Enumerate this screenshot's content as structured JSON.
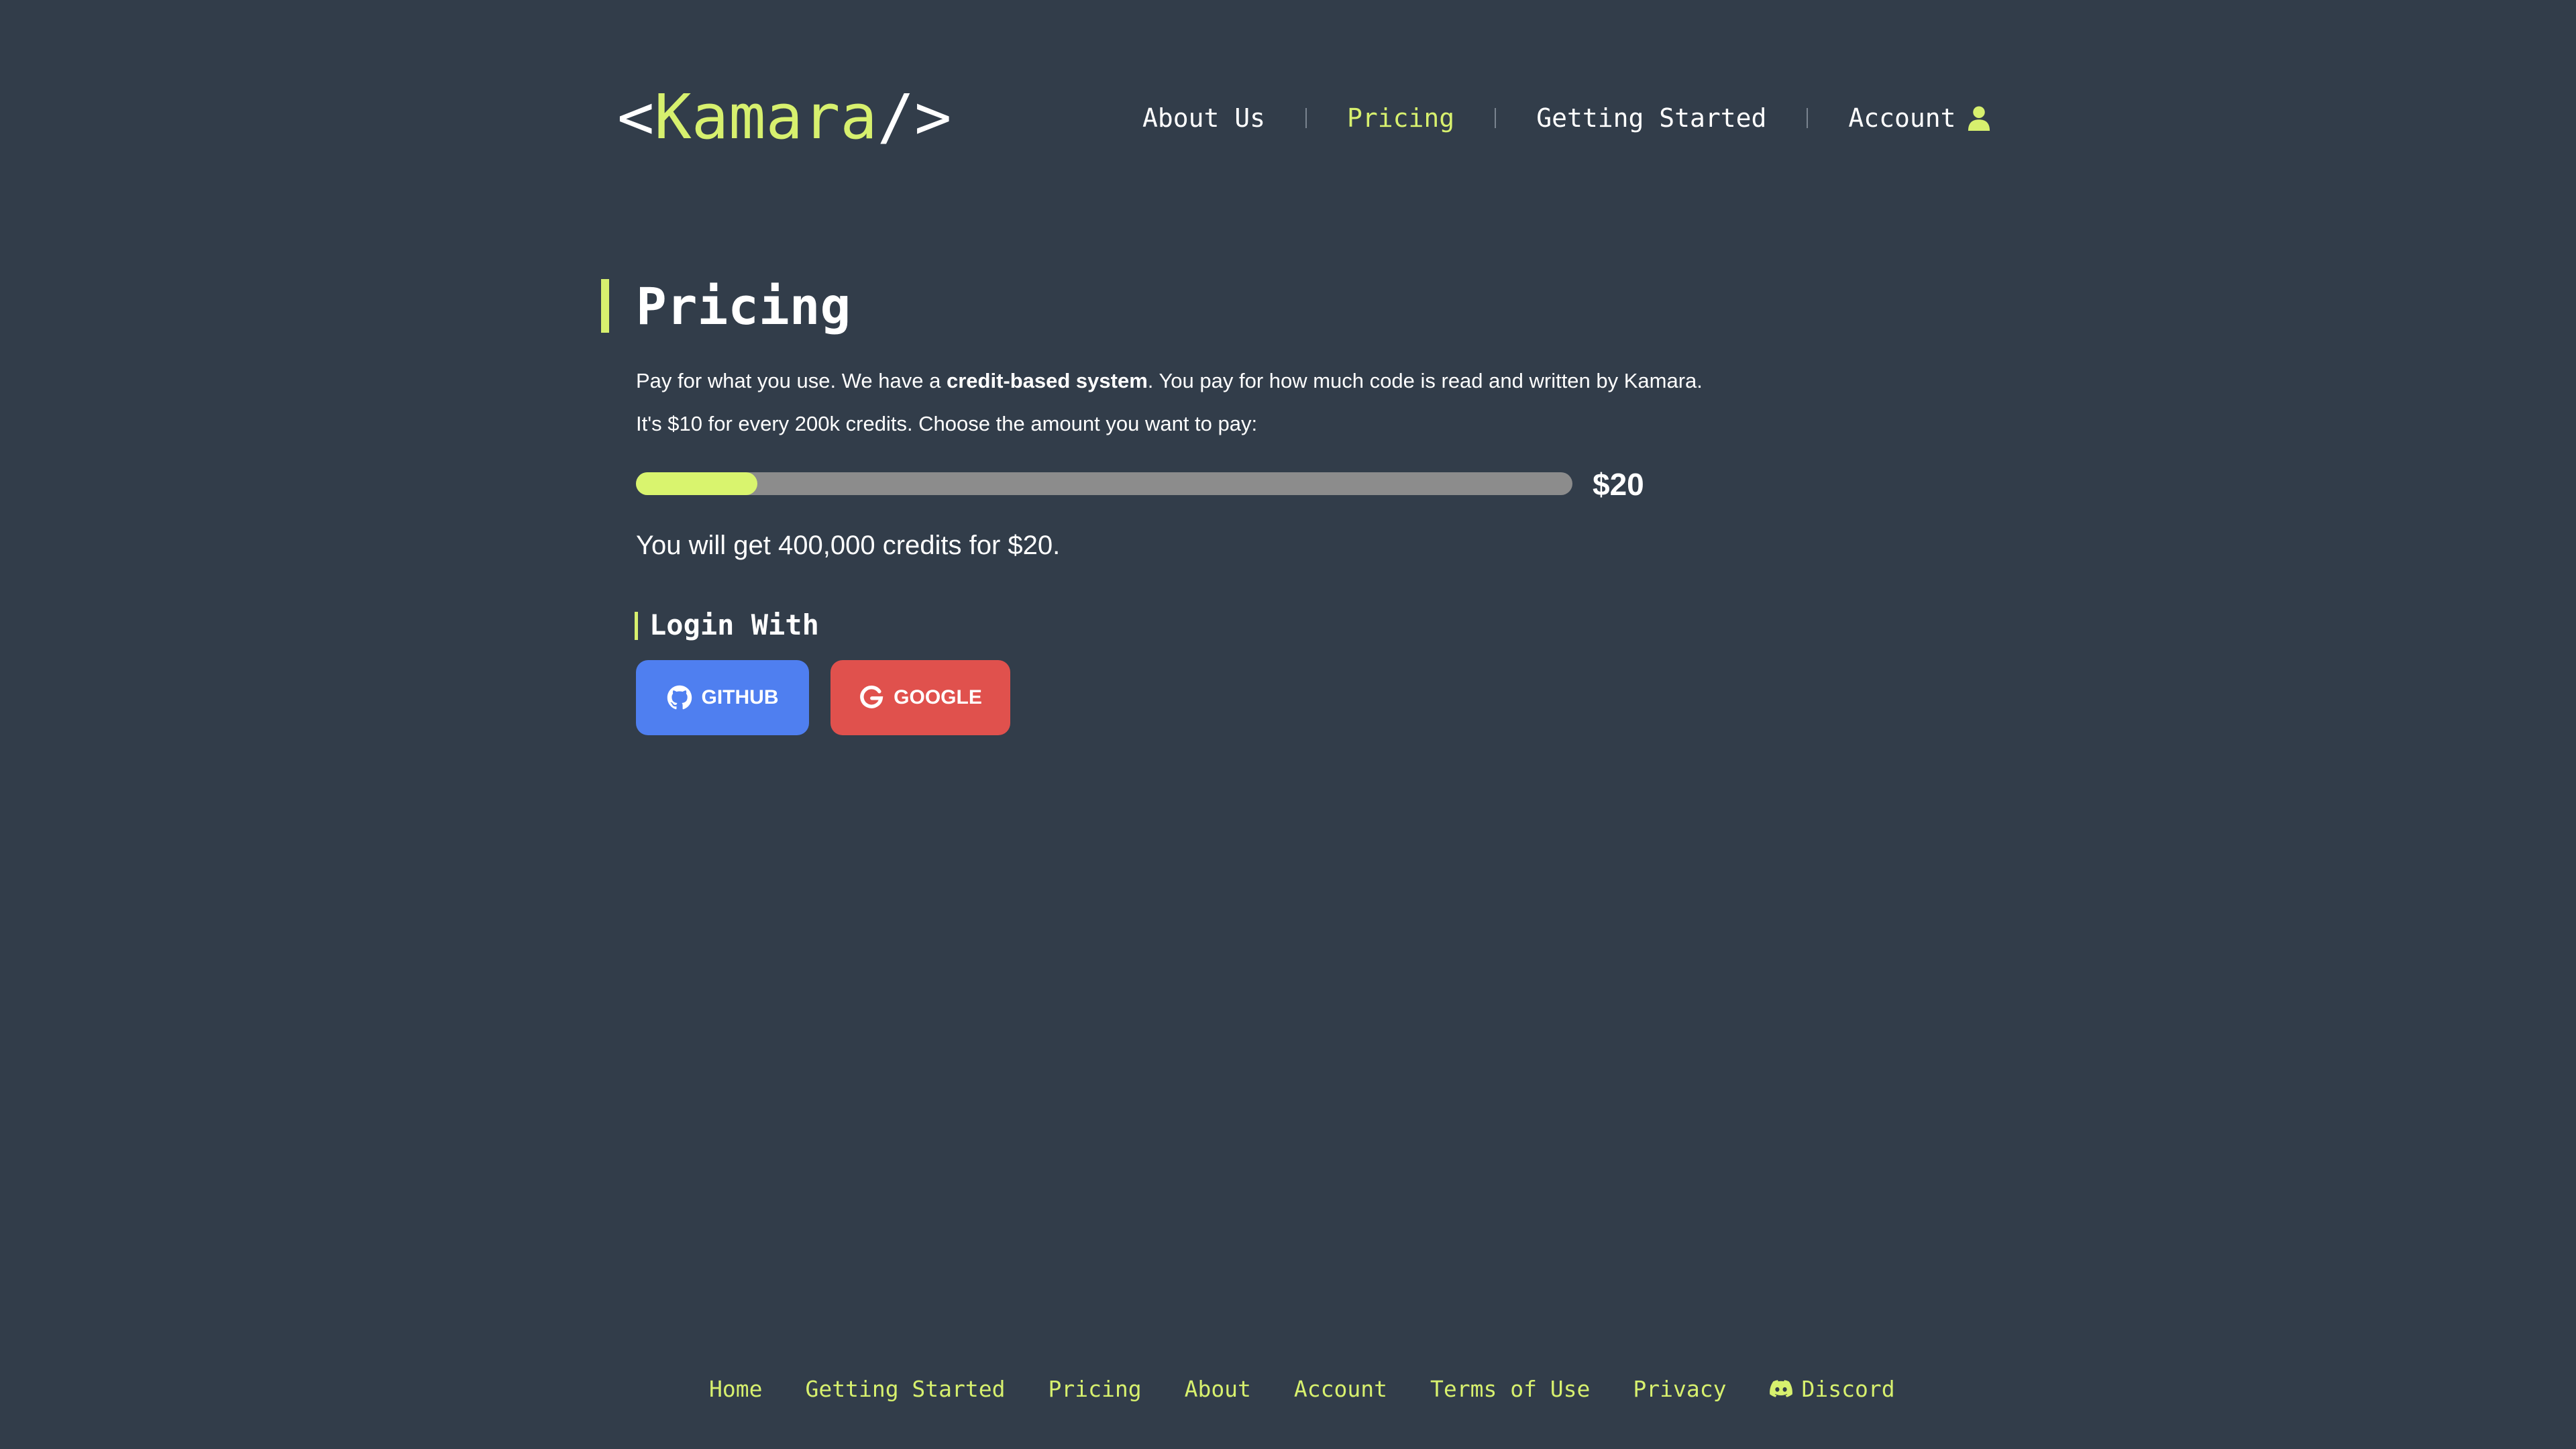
{
  "logo": {
    "open_bracket": "<",
    "name": "Kamara",
    "close_bracket": "/>"
  },
  "nav": {
    "items": [
      {
        "label": "About Us",
        "active": false
      },
      {
        "label": "Pricing",
        "active": true
      },
      {
        "label": "Getting Started",
        "active": false
      },
      {
        "label": "Account",
        "active": false,
        "icon": "user-icon"
      }
    ]
  },
  "main": {
    "title": "Pricing",
    "description_line1_prefix": "Pay for what you use. We have a ",
    "description_line1_bold": "credit-based system",
    "description_line1_suffix": ". You pay for how much code is read and written by Kamara.",
    "description_line2": "It's $10 for every 200k credits. Choose the amount you want to pay:",
    "slider": {
      "value_label": "$20",
      "fill_fraction": 0.13
    },
    "credits_line": "You will get 400,000 credits for $20.",
    "login": {
      "title": "Login With",
      "github_label": "GITHUB",
      "github_icon": "github-icon",
      "google_label": "GOOGLE",
      "google_icon": "google-icon"
    }
  },
  "footer": {
    "links": [
      {
        "label": "Home"
      },
      {
        "label": "Getting Started"
      },
      {
        "label": "Pricing"
      },
      {
        "label": "About"
      },
      {
        "label": "Account"
      },
      {
        "label": "Terms of Use"
      },
      {
        "label": "Privacy"
      },
      {
        "label": "Discord",
        "icon": "discord-icon"
      }
    ]
  },
  "colors": {
    "background": "#323d4a",
    "accent": "#d7f06e",
    "github_button": "#4f7ff0",
    "google_button": "#e0514d",
    "slider_track": "#8c8c8c"
  }
}
